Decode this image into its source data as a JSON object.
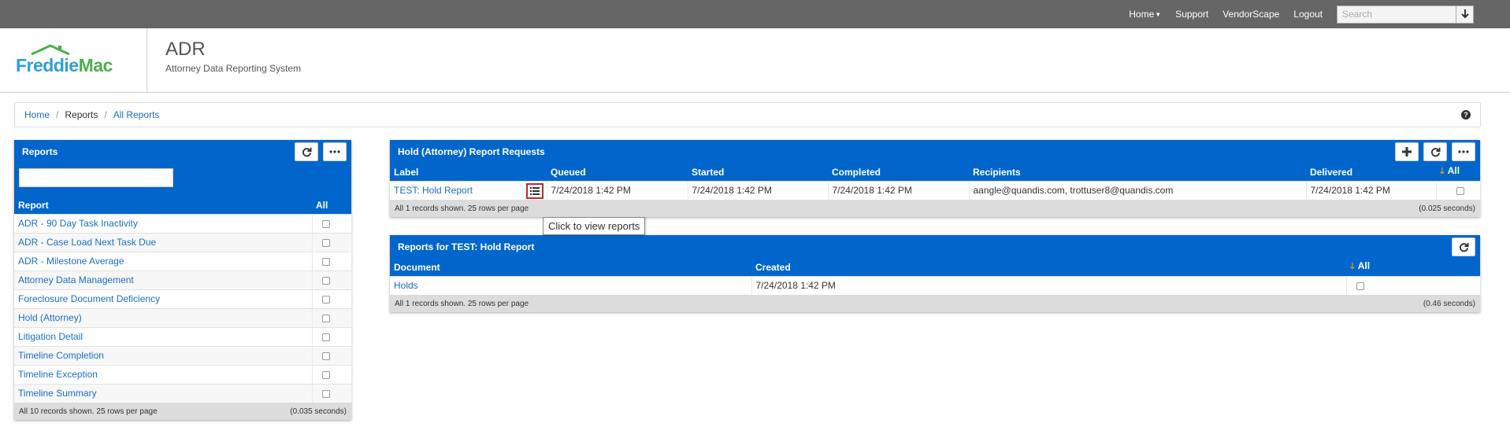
{
  "topnav": {
    "home": "Home",
    "support": "Support",
    "vendorscape": "VendorScape",
    "logout": "Logout",
    "search_placeholder": "Search"
  },
  "header": {
    "logo_freddie": "Freddie",
    "logo_mac": "Mac",
    "app_title": "ADR",
    "app_subtitle": "Attorney Data Reporting System"
  },
  "breadcrumb": {
    "home": "Home",
    "reports": "Reports",
    "all_reports": "All Reports"
  },
  "reports_panel": {
    "title": "Reports",
    "columns": {
      "report": "Report",
      "all": "All"
    },
    "rows": [
      "ADR - 90 Day Task Inactivity",
      "ADR - Case Load Next Task Due",
      "ADR - Milestone Average",
      "Attorney Data Management",
      "Foreclosure Document Deficiency",
      "Hold (Attorney)",
      "Litigation Detail",
      "Timeline Completion",
      "Timeline Exception",
      "Timeline Summary"
    ],
    "footer_left": "All 10 records shown. 25 rows per page",
    "footer_right": "(0.035 seconds)"
  },
  "requests_panel": {
    "title": "Hold (Attorney) Report Requests",
    "columns": {
      "label": "Label",
      "queued": "Queued",
      "started": "Started",
      "completed": "Completed",
      "recipients": "Recipients",
      "delivered": "Delivered",
      "all": "All"
    },
    "row": {
      "label": "TEST: Hold Report",
      "queued": "7/24/2018 1:42 PM",
      "started": "7/24/2018 1:42 PM",
      "completed": "7/24/2018 1:42 PM",
      "recipients": "aangle@quandis.com, trottuser8@quandis.com",
      "delivered": "7/24/2018 1:42 PM"
    },
    "footer_left": "All 1 records shown. 25 rows per page",
    "footer_right": "(0.025 seconds)",
    "tooltip": "Click to view reports"
  },
  "docs_panel": {
    "title": "Reports for TEST: Hold Report",
    "columns": {
      "document": "Document",
      "created": "Created",
      "all": "All"
    },
    "row": {
      "document": "Holds",
      "created": "7/24/2018 1:42 PM"
    },
    "footer_left": "All 1 records shown. 25 rows per page",
    "footer_right": "(0.46 seconds)"
  },
  "colors": {
    "topbar": "#666666",
    "panel_blue": "#0066cc",
    "link": "#1a6fc4",
    "footer_gray": "#dcdcdc",
    "highlight_red": "#c0282d"
  },
  "icons": [
    "chevron-down-icon",
    "refresh-icon",
    "ellipsis-icon",
    "plus-icon",
    "list-icon",
    "sort-down-icon",
    "help-icon"
  ]
}
